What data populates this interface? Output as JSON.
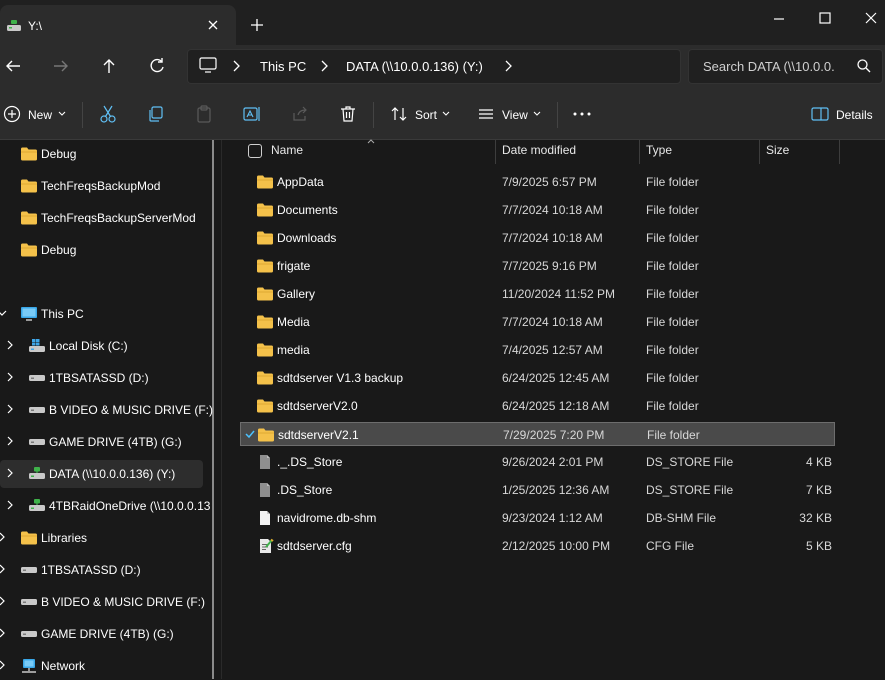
{
  "window": {
    "tab_title": "Y:\\",
    "colors": {
      "accent": "#4cc2ff",
      "folder": "#f4c14a",
      "background": "#191919"
    }
  },
  "breadcrumb": [
    "This PC",
    "DATA (\\\\10.0.0.136) (Y:)"
  ],
  "search": {
    "placeholder": "Search DATA (\\\\10.0.0."
  },
  "toolbar": {
    "new_label": "New",
    "sort_label": "Sort",
    "view_label": "View",
    "details_label": "Details"
  },
  "sidebar": {
    "items": [
      {
        "label": "Debug",
        "icon": "folder-icon"
      },
      {
        "label": "TechFreqsBackupMod",
        "icon": "folder-icon"
      },
      {
        "label": "TechFreqsBackupServerMod",
        "icon": "folder-icon"
      },
      {
        "label": "Debug",
        "icon": "folder-icon"
      },
      {
        "label": "This PC",
        "icon": "pc-icon"
      },
      {
        "label": "Local Disk (C:)",
        "icon": "windows-drive-icon"
      },
      {
        "label": "1TBSATASSD (D:)",
        "icon": "drive-icon"
      },
      {
        "label": "B VIDEO & MUSIC DRIVE (F:)",
        "icon": "drive-icon"
      },
      {
        "label": "GAME DRIVE (4TB) (G:)",
        "icon": "drive-icon"
      },
      {
        "label": "DATA (\\\\10.0.0.136) (Y:)",
        "icon": "network-drive-icon"
      },
      {
        "label": "4TBRaidOneDrive (\\\\10.0.0.13",
        "icon": "network-drive-icon"
      },
      {
        "label": "Libraries",
        "icon": "folder-icon"
      },
      {
        "label": "1TBSATASSD (D:)",
        "icon": "drive-icon"
      },
      {
        "label": "B VIDEO & MUSIC DRIVE (F:)",
        "icon": "drive-icon"
      },
      {
        "label": "GAME DRIVE (4TB) (G:)",
        "icon": "drive-icon"
      },
      {
        "label": "Network",
        "icon": "network-icon"
      }
    ]
  },
  "columns": {
    "name": "Name",
    "date": "Date modified",
    "type": "Type",
    "size": "Size"
  },
  "files": [
    {
      "name": "AppData",
      "date": "7/9/2025 6:57 PM",
      "type": "File folder",
      "size": "",
      "icon": "folder-icon"
    },
    {
      "name": "Documents",
      "date": "7/7/2024 10:18 AM",
      "type": "File folder",
      "size": "",
      "icon": "folder-icon"
    },
    {
      "name": "Downloads",
      "date": "7/7/2024 10:18 AM",
      "type": "File folder",
      "size": "",
      "icon": "folder-icon"
    },
    {
      "name": "frigate",
      "date": "7/7/2025 9:16 PM",
      "type": "File folder",
      "size": "",
      "icon": "folder-icon"
    },
    {
      "name": "Gallery",
      "date": "11/20/2024 11:52 PM",
      "type": "File folder",
      "size": "",
      "icon": "folder-icon"
    },
    {
      "name": "Media",
      "date": "7/7/2024 10:18 AM",
      "type": "File folder",
      "size": "",
      "icon": "folder-icon"
    },
    {
      "name": "media",
      "date": "7/4/2025 12:57 AM",
      "type": "File folder",
      "size": "",
      "icon": "folder-icon"
    },
    {
      "name": "sdtdserver V1.3 backup",
      "date": "6/24/2025 12:45 AM",
      "type": "File folder",
      "size": "",
      "icon": "folder-icon"
    },
    {
      "name": "sdtdserverV2.0",
      "date": "6/24/2025 12:18 AM",
      "type": "File folder",
      "size": "",
      "icon": "folder-icon"
    },
    {
      "name": "sdtdserverV2.1",
      "date": "7/29/2025 7:20 PM",
      "type": "File folder",
      "size": "",
      "icon": "folder-icon",
      "selected": true
    },
    {
      "name": "._.DS_Store",
      "date": "9/26/2024 2:01 PM",
      "type": "DS_STORE File",
      "size": "4 KB",
      "icon": "gray-file-icon"
    },
    {
      "name": ".DS_Store",
      "date": "1/25/2025 12:36 AM",
      "type": "DS_STORE File",
      "size": "7 KB",
      "icon": "gray-file-icon"
    },
    {
      "name": "navidrome.db-shm",
      "date": "9/23/2024 1:12 AM",
      "type": "DB-SHM File",
      "size": "32 KB",
      "icon": "blank-file-icon"
    },
    {
      "name": "sdtdserver.cfg",
      "date": "2/12/2025 10:00 PM",
      "type": "CFG File",
      "size": "5 KB",
      "icon": "cfg-file-icon"
    }
  ]
}
